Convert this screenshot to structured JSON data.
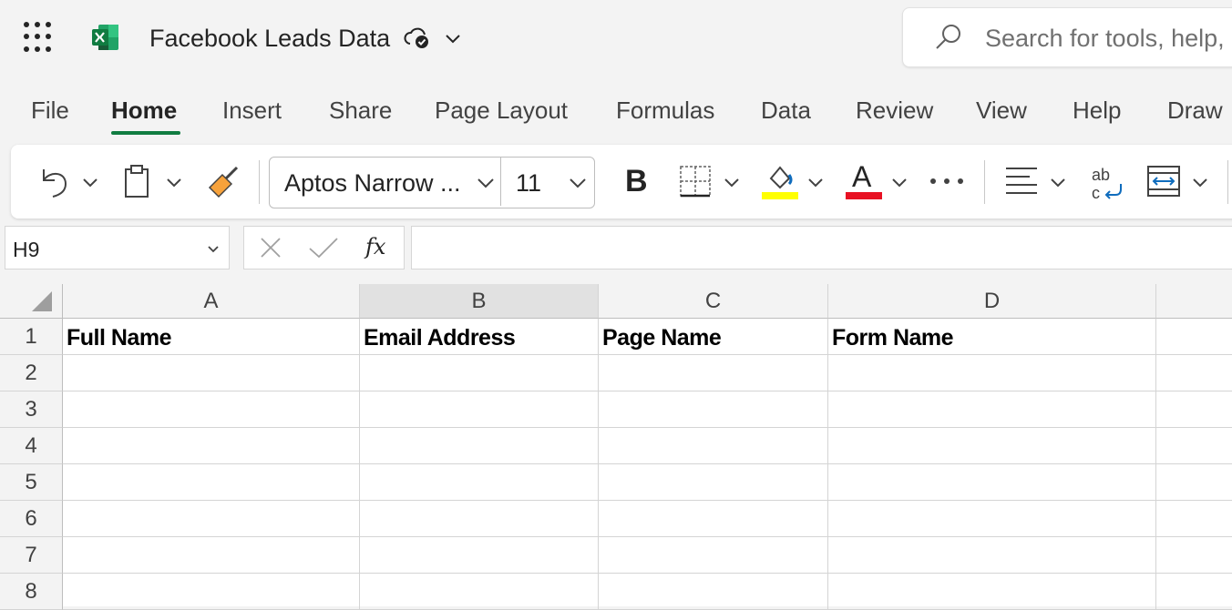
{
  "app": {
    "title": "Facebook Leads Data",
    "search_placeholder": "Search for tools, help,"
  },
  "tabs": [
    "File",
    "Home",
    "Insert",
    "Share",
    "Page Layout",
    "Formulas",
    "Data",
    "Review",
    "View",
    "Help",
    "Draw"
  ],
  "active_tab": "Home",
  "ribbon": {
    "font_name": "Aptos Narrow ...",
    "font_size": "11",
    "bold_label": "B",
    "font_color_label": "A",
    "highlight_color": "#ffff00",
    "font_color": "#e81123"
  },
  "formula_bar": {
    "name_box": "H9",
    "fx_label": "fx",
    "formula": ""
  },
  "sheet": {
    "columns": [
      "A",
      "B",
      "C",
      "D"
    ],
    "rows": [
      "1",
      "2",
      "3",
      "4",
      "5",
      "6",
      "7",
      "8"
    ],
    "header_row": [
      "Full Name",
      "Email Address",
      "Page Name",
      "Form Name"
    ]
  },
  "colors": {
    "accent": "#107c41"
  }
}
